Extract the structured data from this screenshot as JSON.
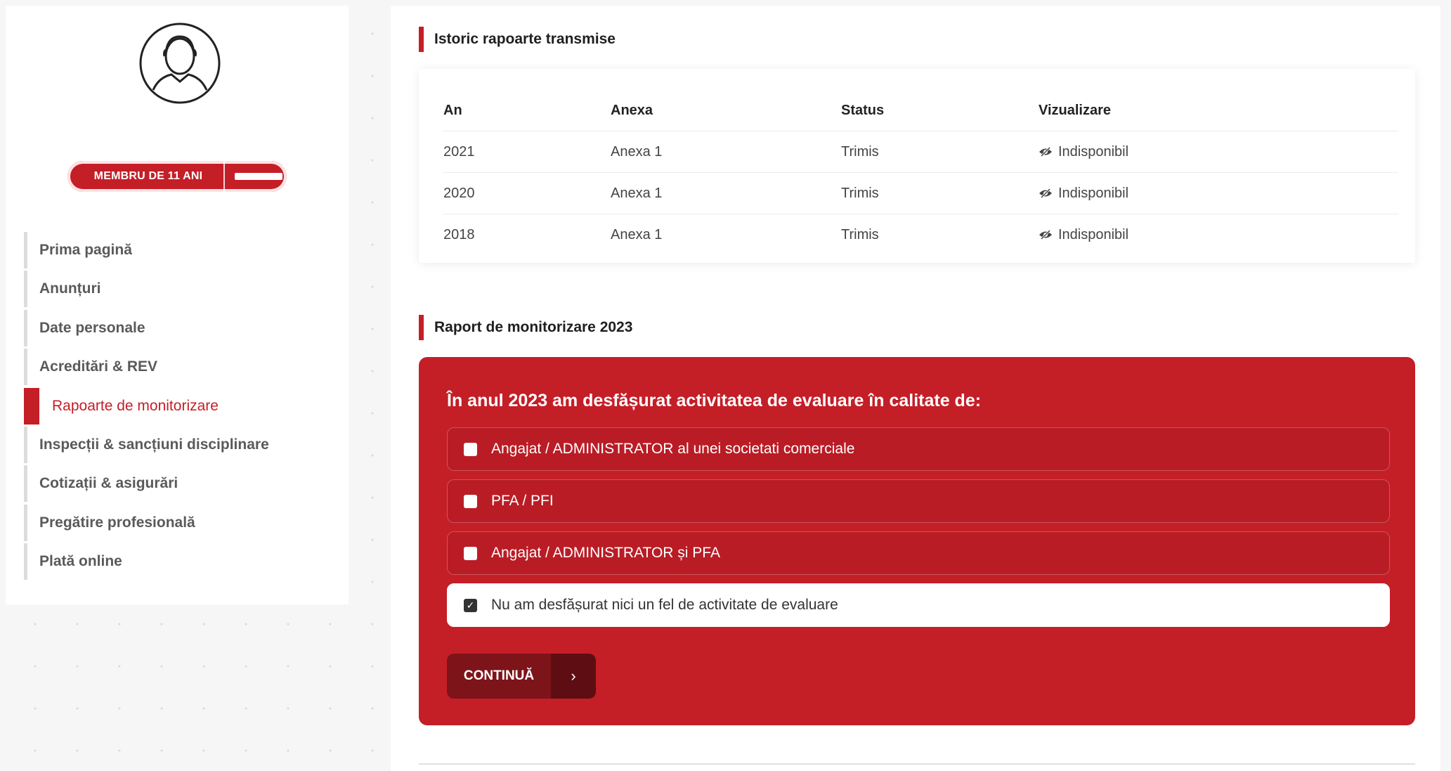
{
  "status": {
    "online_color": "#22b14c"
  },
  "profile": {
    "avatar_icon": "user-avatar-icon",
    "member_badge": "MEMBRU DE 11 ANI"
  },
  "sidebar": {
    "items": [
      {
        "label": "Prima pagină",
        "active": false
      },
      {
        "label": "Anunțuri",
        "active": false
      },
      {
        "label": "Date personale",
        "active": false
      },
      {
        "label": "Acreditări & REV",
        "active": false
      },
      {
        "label": "Rapoarte de monitorizare",
        "active": true
      },
      {
        "label": "Inspecții & sancțiuni disciplinare",
        "active": false
      },
      {
        "label": "Cotizații & asigurări",
        "active": false
      },
      {
        "label": "Pregătire profesională",
        "active": false
      },
      {
        "label": "Plată online",
        "active": false
      }
    ]
  },
  "history": {
    "title": "Istoric rapoarte transmise",
    "columns": [
      "An",
      "Anexa",
      "Status",
      "Vizualizare"
    ],
    "rows": [
      {
        "year": "2021",
        "annex": "Anexa 1",
        "status": "Trimis",
        "view": "Indisponibil",
        "view_icon": "eye-slash-icon"
      },
      {
        "year": "2020",
        "annex": "Anexa 1",
        "status": "Trimis",
        "view": "Indisponibil",
        "view_icon": "eye-slash-icon"
      },
      {
        "year": "2018",
        "annex": "Anexa 1",
        "status": "Trimis",
        "view": "Indisponibil",
        "view_icon": "eye-slash-icon"
      }
    ]
  },
  "report": {
    "title": "Raport de monitorizare 2023",
    "heading": "În anul 2023 am desfășurat activitatea de evaluare în calitate de:",
    "options": [
      {
        "label": "Angajat / ADMINISTRATOR al unei societati comerciale",
        "checked": false
      },
      {
        "label": "PFA / PFI",
        "checked": false
      },
      {
        "label": "Angajat / ADMINISTRATOR și PFA",
        "checked": false
      },
      {
        "label": "Nu am desfășurat nici un fel de activitate de evaluare",
        "checked": true
      }
    ],
    "continue_label": "CONTINUĂ",
    "continue_arrow": "›"
  },
  "colors": {
    "accent": "#c41e27",
    "button_dark": "#7d141a"
  }
}
